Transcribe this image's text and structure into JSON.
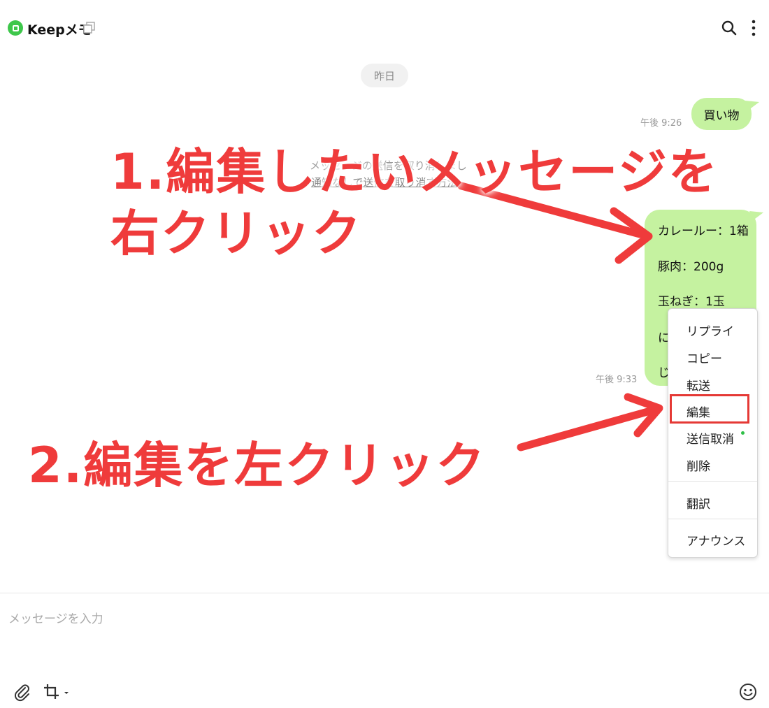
{
  "header": {
    "title": "Keepメモ",
    "icons": [
      "keep-icon",
      "copy-icon",
      "search-icon",
      "more-vertical-icon"
    ]
  },
  "chat": {
    "date_label": "昨日",
    "messages": [
      {
        "text": "買い物",
        "time": "午後 9:26"
      },
      {
        "lines": [
          "カレールー：1箱",
          "豚肉：200g",
          "玉ねぎ：1玉",
          "に",
          "じ"
        ],
        "time": "午後 9:33"
      }
    ],
    "system_text_1": "メッセージの送信を取り消しまし",
    "system_text_2": "通知なしで送信を取り消す方法"
  },
  "context_menu": {
    "items": [
      "リプライ",
      "コピー",
      "転送",
      "編集",
      "送信取消",
      "削除",
      "翻訳",
      "アナウンス"
    ],
    "highlighted": "編集"
  },
  "annotations": {
    "step1_line1": "1.編集したいメッセージを",
    "step1_line2": "右クリック",
    "step2": "2.編集を左クリック",
    "color": "#ef3b3b"
  },
  "composer": {
    "placeholder": "メッセージを入力",
    "icons": [
      "paperclip-icon",
      "crop-icon",
      "emoji-icon"
    ]
  }
}
